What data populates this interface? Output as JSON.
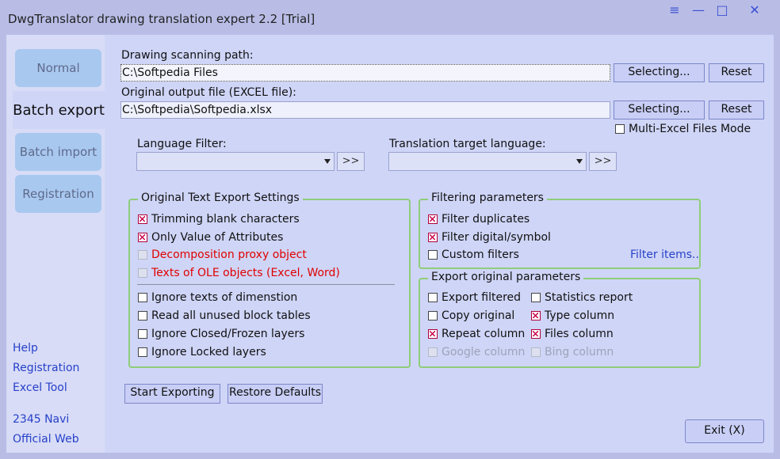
{
  "window": {
    "title": "DwgTranslator drawing translation expert 2.2 [Trial]"
  },
  "titlebar_buttons": {
    "menu": "≡",
    "minimize": "—",
    "maximize": "□",
    "close": "✕"
  },
  "nav": {
    "items": [
      {
        "label": "Normal"
      },
      {
        "label": "Batch export"
      },
      {
        "label": "Batch import"
      },
      {
        "label": "Registration"
      }
    ],
    "active": "Batch export"
  },
  "side_links": {
    "help": "Help",
    "registration": "Registration",
    "excel_tool": "Excel Tool",
    "navi": "2345 Navi",
    "official_web": "Official Web"
  },
  "scan": {
    "label": "Drawing scanning path:",
    "value": "C:\\Softpedia Files",
    "select_label": "Selecting...",
    "reset_label": "Reset"
  },
  "output": {
    "label": "Original output file (EXCEL file):",
    "value": "C:\\Softpedia\\Softpedia.xlsx",
    "select_label": "Selecting...",
    "reset_label": "Reset"
  },
  "multi_excel": {
    "label": "Multi-Excel Files Mode",
    "checked": false
  },
  "language_filter": {
    "label": "Language Filter:",
    "value": "",
    "more": ">>"
  },
  "target_language": {
    "label": "Translation target language:",
    "value": "",
    "more": ">>"
  },
  "text_export": {
    "title": "Original Text Export Settings",
    "trim_blank": "Trimming blank characters",
    "only_value": "Only Value of Attributes",
    "decomposition": "Decomposition proxy object",
    "ole_texts": "Texts of OLE objects (Excel, Word)",
    "ignore_dimension": "Ignore texts of dimenstion",
    "read_unused": "Read all unused block tables",
    "ignore_closed": "Ignore Closed/Frozen layers",
    "ignore_locked": "Ignore Locked layers"
  },
  "filtering": {
    "title": "Filtering parameters",
    "duplicates": "Filter duplicates",
    "digital": "Filter digital/symbol",
    "custom": "Custom filters",
    "filter_items": "Filter items.."
  },
  "export_params": {
    "title": "Export original parameters",
    "export_filtered": "Export filtered",
    "statistics": "Statistics report",
    "copy_original": "Copy original",
    "type_column": "Type column",
    "repeat_column": "Repeat column",
    "files_column": "Files column",
    "google_column": "Google column",
    "bing_column": "Bing column"
  },
  "actions": {
    "start": "Start Exporting",
    "restore": "Restore Defaults",
    "exit": "Exit (X)"
  },
  "colors": {
    "accent_green": "#8fcd7a",
    "link_blue": "#2741c9",
    "warning_red": "#e00000",
    "background": "#cfd5f7"
  }
}
